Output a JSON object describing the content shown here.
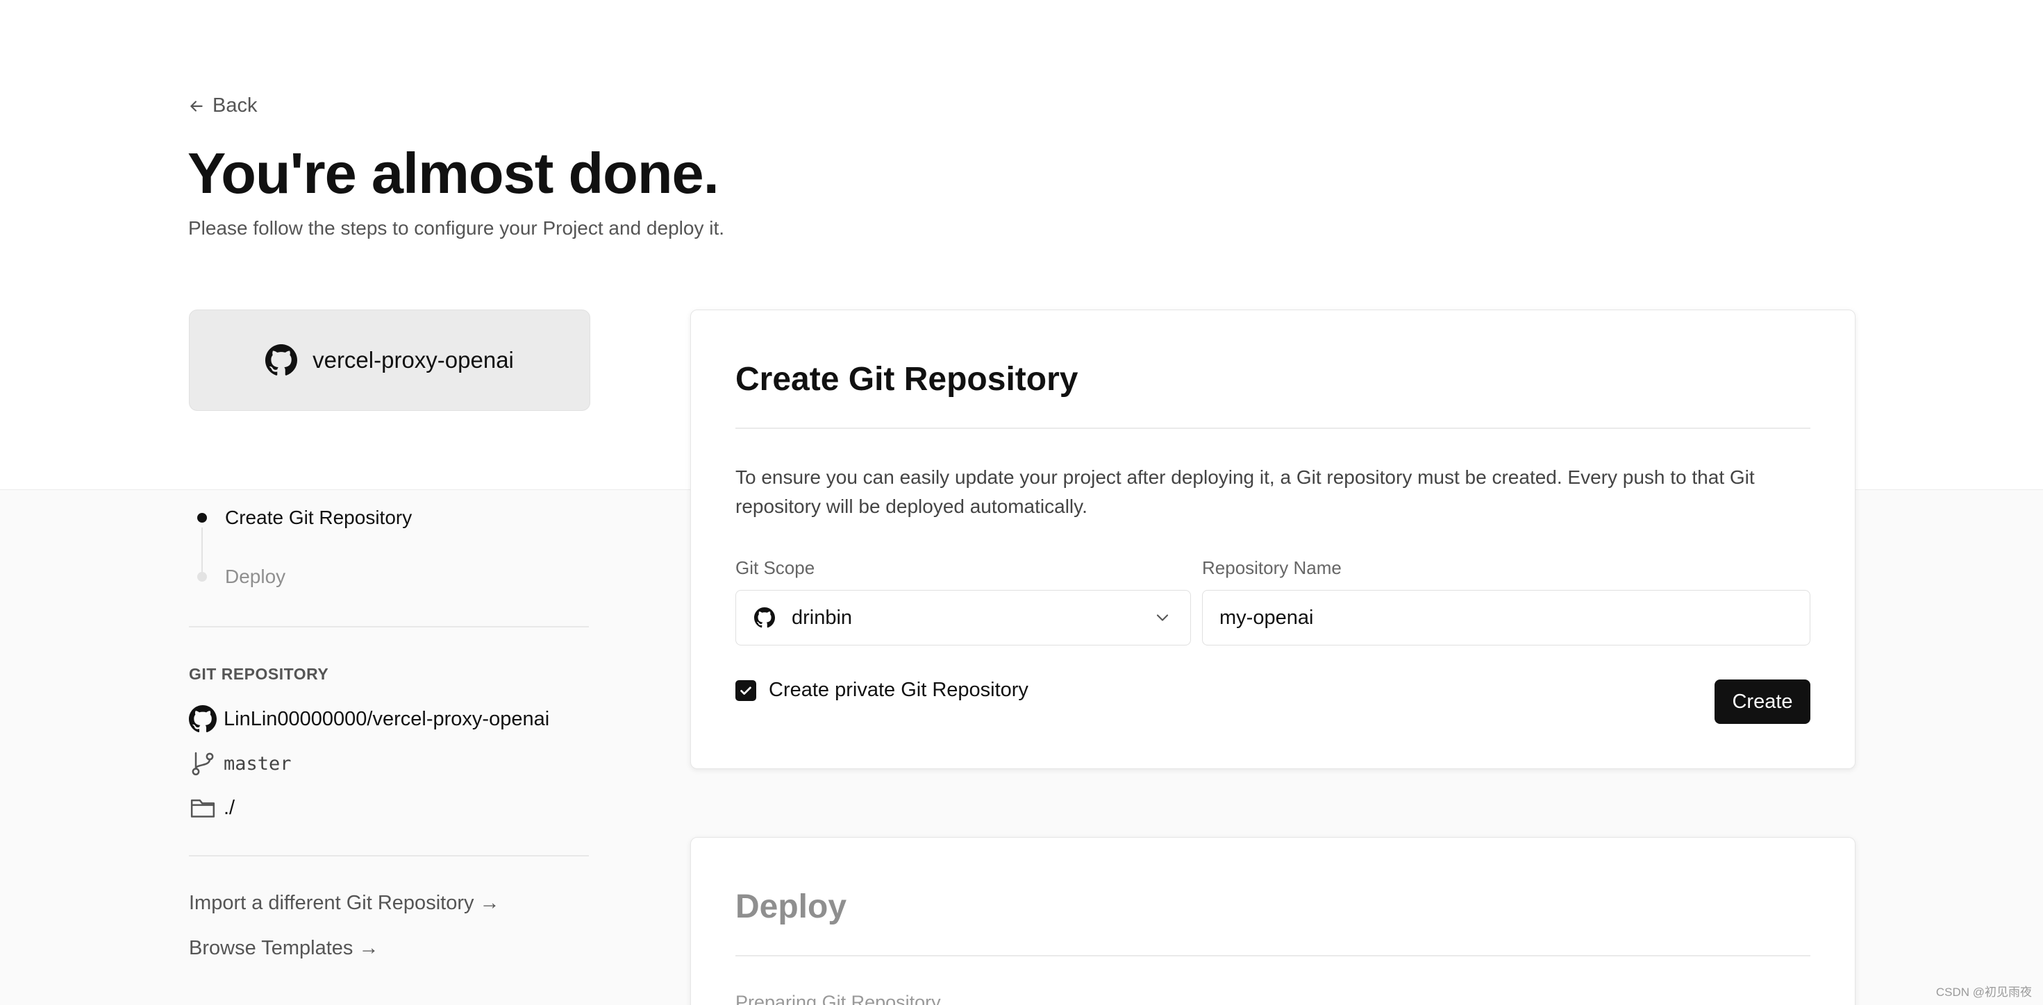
{
  "header": {
    "back_label": "Back",
    "title": "You're almost done.",
    "subtitle": "Please follow the steps to configure your Project and deploy it."
  },
  "repo_card": {
    "name": "vercel-proxy-openai",
    "icon": "github-icon"
  },
  "steps": [
    {
      "label": "Create Git Repository",
      "state": "active"
    },
    {
      "label": "Deploy",
      "state": "pending"
    }
  ],
  "git_repository": {
    "heading": "GIT REPOSITORY",
    "repo": "LinLin00000000/vercel-proxy-openai",
    "branch": "master",
    "root": "./"
  },
  "links": {
    "import_other": "Import a different Git Repository →",
    "browse_templates": "Browse Templates →"
  },
  "create_card": {
    "title": "Create Git Repository",
    "description": "To ensure you can easily update your project after deploying it, a Git repository must be created. Every push to that Git repository will be deployed automatically.",
    "scope_label": "Git Scope",
    "scope_value": "drinbin",
    "repo_name_label": "Repository Name",
    "repo_name_value": "my-openai",
    "private_label": "Create private Git Repository",
    "private_checked": true,
    "create_button": "Create"
  },
  "deploy_card": {
    "title": "Deploy",
    "subtitle": "Preparing Git Repository"
  },
  "watermark": "CSDN @初见雨夜",
  "colors": {
    "primary": "#111111",
    "muted": "#8f8f8f",
    "band": "#fafafa",
    "card_bg": "#ebebeb"
  }
}
